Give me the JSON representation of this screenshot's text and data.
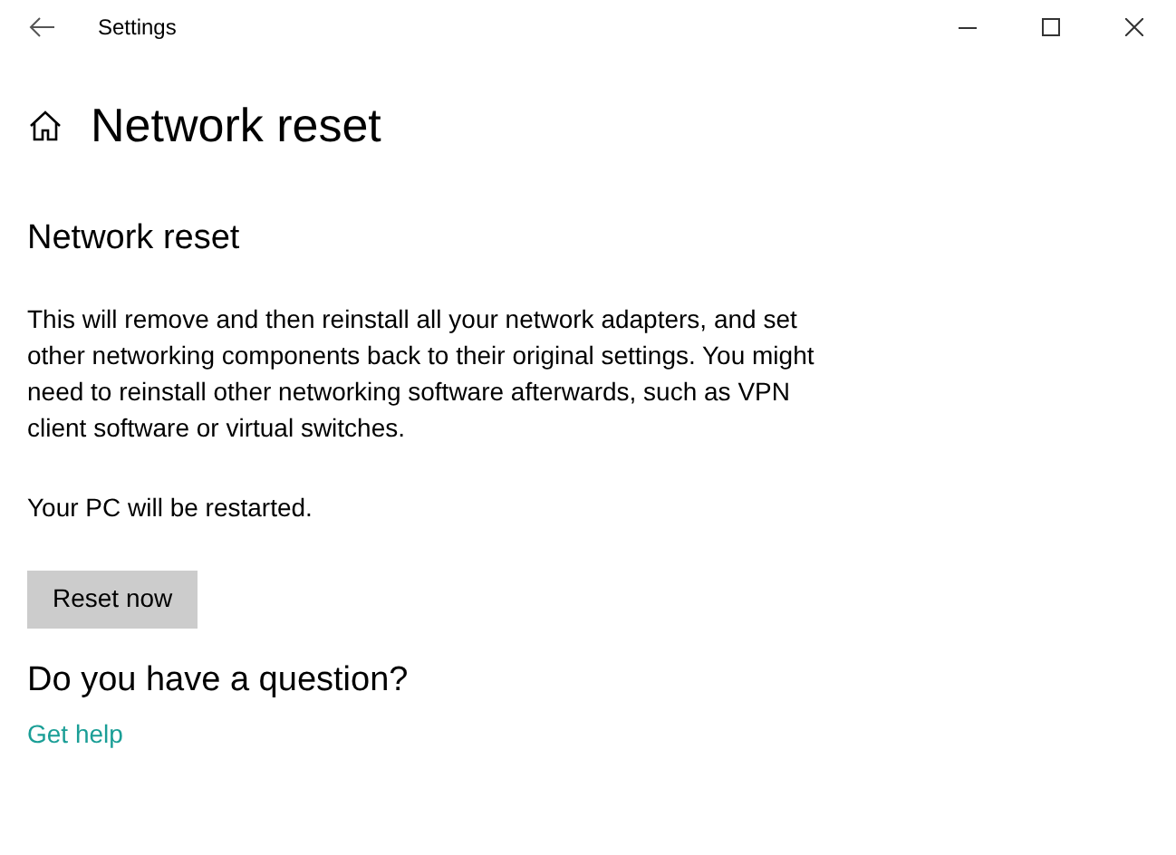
{
  "window": {
    "title": "Settings"
  },
  "page": {
    "title": "Network reset"
  },
  "section": {
    "heading": "Network reset",
    "description": "This will remove and then reinstall all your network adapters, and set other networking components back to their original settings. You might need to reinstall other networking software afterwards, such as VPN client software or virtual switches.",
    "note": "Your PC will be restarted.",
    "button": "Reset now"
  },
  "help": {
    "heading": "Do you have a question?",
    "link": "Get help"
  }
}
